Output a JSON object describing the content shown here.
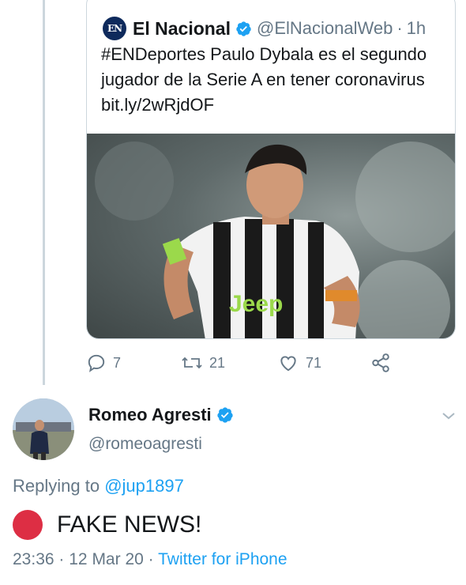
{
  "quoted_tweet": {
    "logo_text": "EN",
    "name": "El Nacional",
    "handle": "@ElNacionalWeb",
    "separator": "·",
    "time": "1h",
    "text": "#ENDeportes Paulo Dybala es el segundo jugador de la Serie A en tener coronavirus bit.ly/2wRjdOF",
    "image_alt": "Football player in black-and-white striped jersey"
  },
  "actions": {
    "replies": "7",
    "retweets": "21",
    "likes": "71"
  },
  "tweet": {
    "name": "Romeo Agresti",
    "handle": "@romeoagresti",
    "replying_prefix": "Replying to",
    "replying_to": "@jup1897",
    "text": "FAKE NEWS!",
    "time": "23:36",
    "dot1": "·",
    "date": "12 Mar 20",
    "dot2": "·",
    "source": "Twitter for iPhone"
  },
  "colors": {
    "accent": "#1da1f2",
    "muted": "#657786",
    "border": "#ccd6dd",
    "red_circle": "#dd2e44"
  },
  "icons": [
    "verified-badge-icon",
    "reply-icon",
    "retweet-icon",
    "like-icon",
    "share-icon",
    "chevron-down-icon",
    "red-circle-emoji"
  ]
}
